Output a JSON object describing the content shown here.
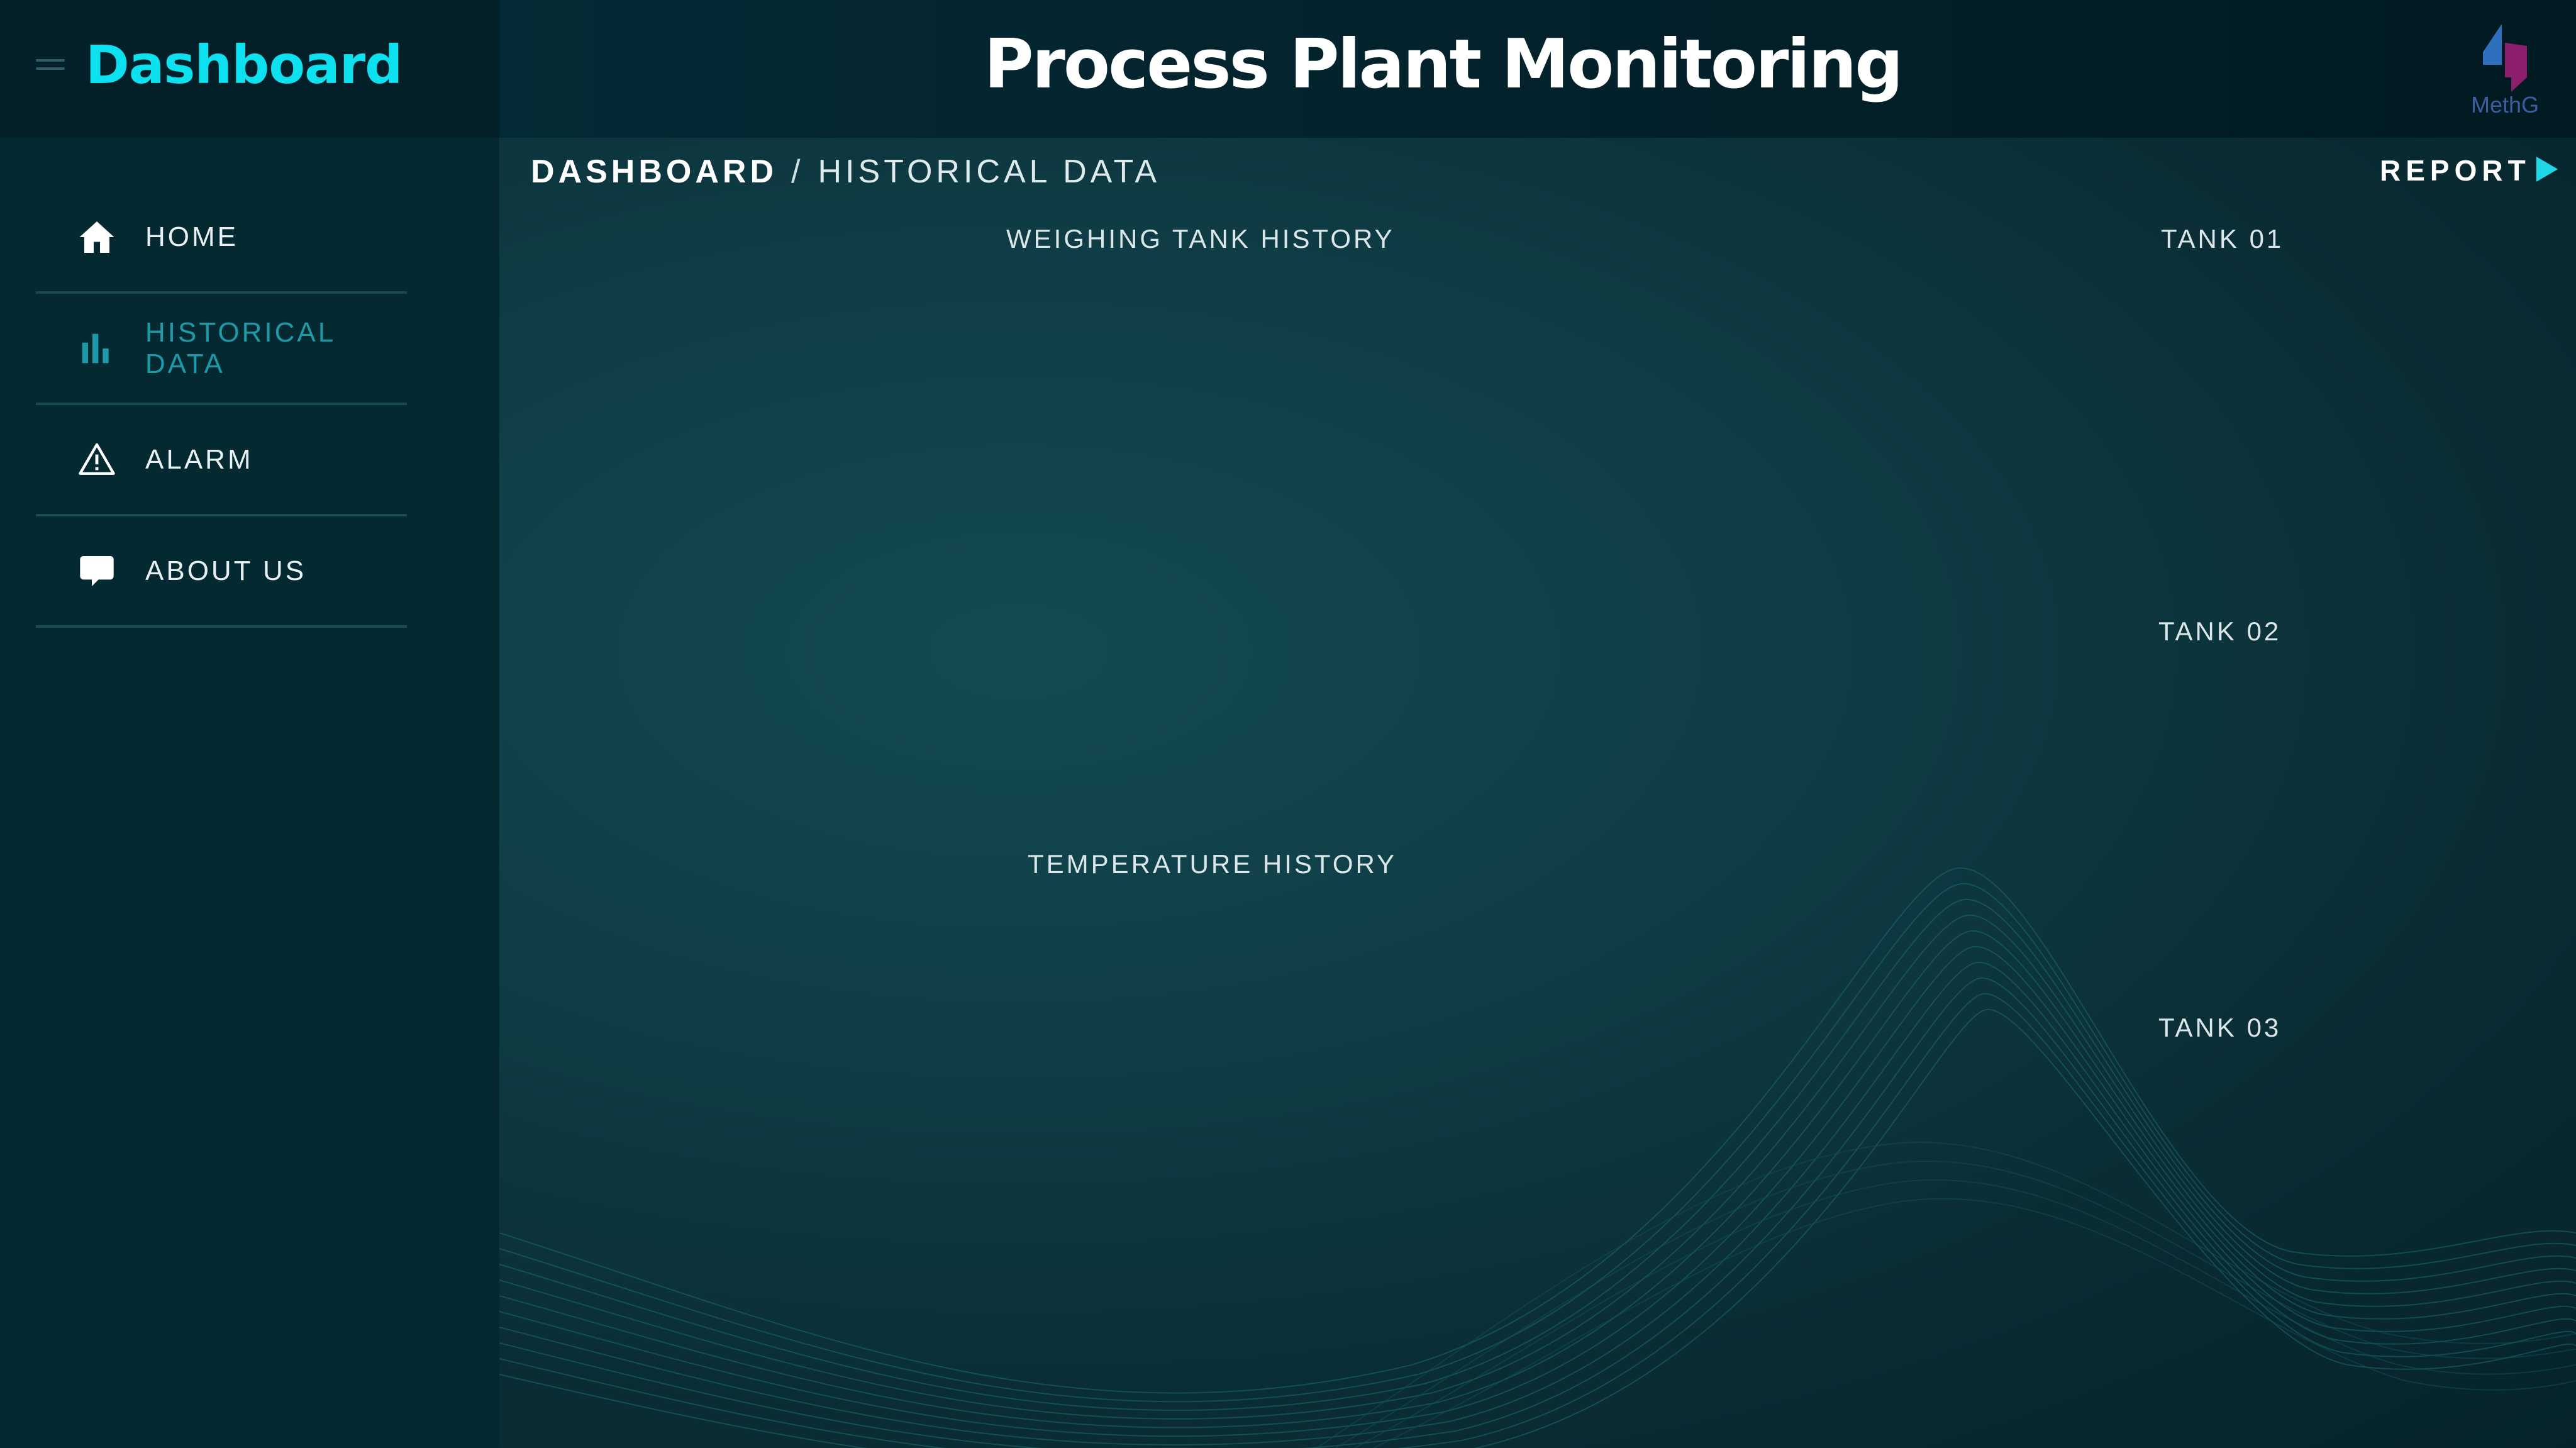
{
  "sidebar": {
    "brand": "Dashboard",
    "items": [
      {
        "label": "HOME",
        "icon": "home-icon",
        "active": false
      },
      {
        "label": "HISTORICAL DATA",
        "icon": "bar-chart-icon",
        "active": true
      },
      {
        "label": "ALARM",
        "icon": "warning-icon",
        "active": false
      },
      {
        "label": "ABOUT US",
        "icon": "chat-bubble-icon",
        "active": false
      }
    ]
  },
  "header": {
    "title": "Process Plant Monitoring",
    "logo_text": "MethG"
  },
  "breadcrumb": {
    "root": "DASHBOARD",
    "separator": "/",
    "current": "HISTORICAL DATA"
  },
  "report": {
    "label": "REPORT"
  },
  "sections": {
    "weighing_history": "WEIGHING TANK  HISTORY",
    "temperature_history": "TEMPERATURE HISTORY"
  },
  "tanks": [
    "TANK 01",
    "TANK 02",
    "TANK 03"
  ],
  "colors": {
    "accent": "#0de0ef",
    "active_nav": "#1d9aa8",
    "background": "#0f3d46"
  }
}
